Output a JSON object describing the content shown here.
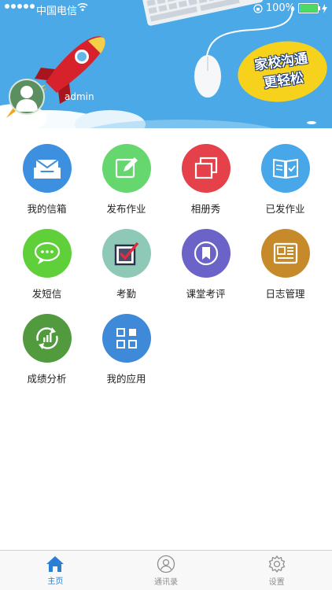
{
  "status_bar": {
    "carrier": "中国电信",
    "battery_percent": "100%",
    "battery_level": 1.0
  },
  "banner": {
    "username": "admin",
    "slogan_line1": "家校沟通",
    "slogan_line2": "更轻松"
  },
  "menu": [
    {
      "label": "我的信箱",
      "icon": "mail-tray-icon",
      "color": "#3d8fe0"
    },
    {
      "label": "发布作业",
      "icon": "edit-icon",
      "color": "#66d66e"
    },
    {
      "label": "相册秀",
      "icon": "photo-stack-icon",
      "color": "#e4414a"
    },
    {
      "label": "已发作业",
      "icon": "book-check-icon",
      "color": "#48a7e9"
    },
    {
      "label": "发短信",
      "icon": "chat-bubble-icon",
      "color": "#5fcf3a"
    },
    {
      "label": "考勤",
      "icon": "checkbox-icon",
      "color": "#8ec9b7"
    },
    {
      "label": "课堂考评",
      "icon": "bookmark-icon",
      "color": "#6b63c8"
    },
    {
      "label": "日志管理",
      "icon": "newspaper-icon",
      "color": "#c78a2b"
    },
    {
      "label": "成绩分析",
      "icon": "chart-refresh-icon",
      "color": "#519b3e"
    },
    {
      "label": "我的应用",
      "icon": "app-grid-icon",
      "color": "#3f8ad8"
    }
  ],
  "tabbar": {
    "home": "主页",
    "contacts": "通讯录",
    "settings": "设置",
    "active_color": "#2a7fd4"
  }
}
